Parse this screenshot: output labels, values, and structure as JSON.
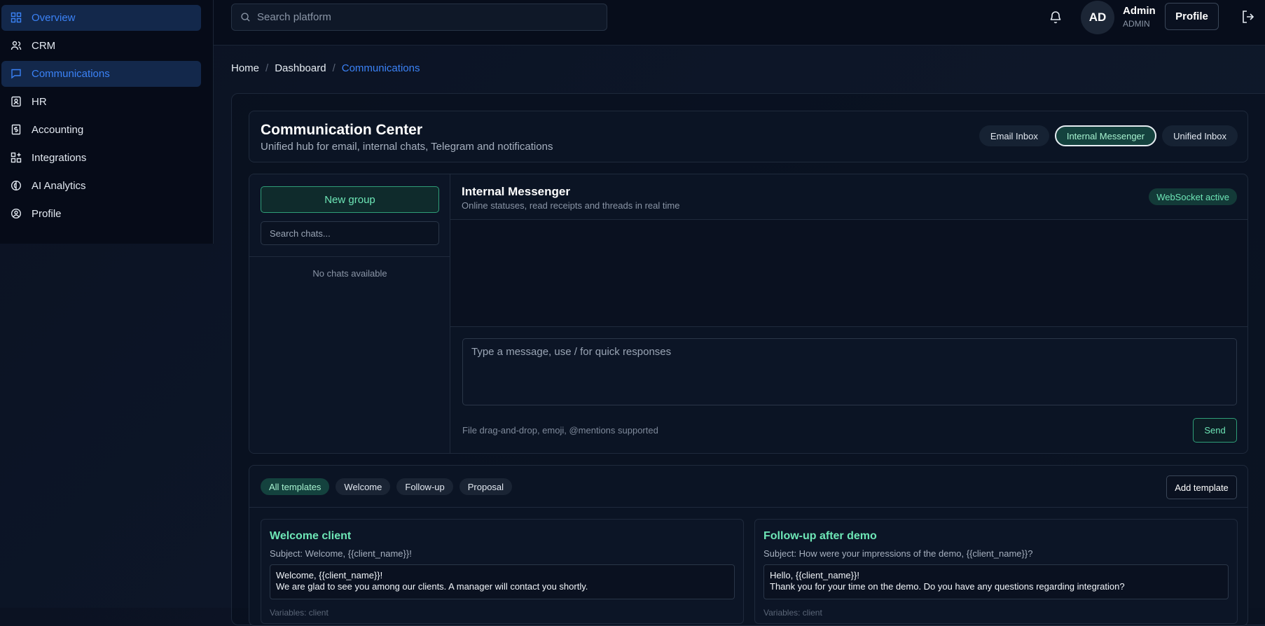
{
  "sidebar": {
    "items": [
      {
        "label": "Overview",
        "icon": "grid-icon"
      },
      {
        "label": "CRM",
        "icon": "users-icon"
      },
      {
        "label": "Communications",
        "icon": "chat-icon"
      },
      {
        "label": "HR",
        "icon": "id-badge-icon"
      },
      {
        "label": "Accounting",
        "icon": "receipt-icon"
      },
      {
        "label": "Integrations",
        "icon": "puzzle-icon"
      },
      {
        "label": "AI Analytics",
        "icon": "brain-icon"
      },
      {
        "label": "Profile",
        "icon": "user-circle-icon"
      }
    ]
  },
  "topbar": {
    "search_placeholder": "Search platform",
    "avatar_initials": "AD",
    "user_name": "Admin",
    "user_role": "ADMIN",
    "profile_label": "Profile"
  },
  "breadcrumb": {
    "home": "Home",
    "dashboard": "Dashboard",
    "current": "Communications"
  },
  "header": {
    "title": "Communication Center",
    "subtitle": "Unified hub for email, internal chats, Telegram and notifications",
    "tabs": [
      "Email Inbox",
      "Internal Messenger",
      "Unified Inbox"
    ]
  },
  "messenger": {
    "new_group_label": "New group",
    "chat_search_placeholder": "Search chats...",
    "empty_label": "No chats available",
    "title": "Internal Messenger",
    "subtitle": "Online statuses, read receipts and threads in real time",
    "status_badge": "WebSocket active",
    "input_placeholder": "Type a message, use / for quick responses",
    "hint": "File drag-and-drop, emoji, @mentions supported",
    "send_label": "Send"
  },
  "templates": {
    "filters": [
      "All templates",
      "Welcome",
      "Follow-up",
      "Proposal"
    ],
    "add_label": "Add template",
    "cards": [
      {
        "name": "Welcome client",
        "subject": "Subject: Welcome, {{client_name}}!",
        "body_line1": "Welcome, {{client_name}}!",
        "body_line2": "We are glad to see you among our clients. A manager will contact you shortly.",
        "vars": "Variables: client"
      },
      {
        "name": "Follow-up after demo",
        "subject": "Subject: How were your impressions of the demo, {{client_name}}?",
        "body_line1": "Hello, {{client_name}}!",
        "body_line2": "Thank you for your time on the demo. Do you have any questions regarding integration?",
        "vars": "Variables: client"
      }
    ]
  },
  "colors": {
    "accent_blue": "#3b82f6",
    "accent_green": "#6ee7b7",
    "background": "#0b1222"
  }
}
